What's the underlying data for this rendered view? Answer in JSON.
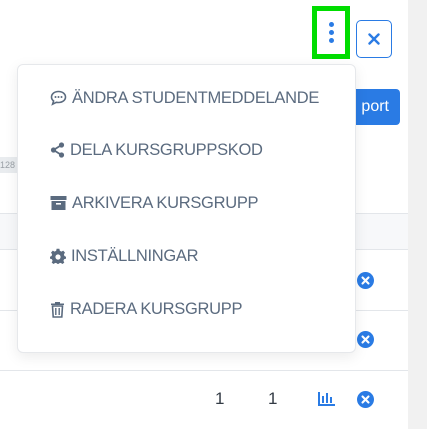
{
  "toolbar": {
    "more_icon": "kebab-vertical-icon",
    "close_icon": "close-x-icon",
    "highlight_color": "#00dd00",
    "accent_color": "#2a7be4"
  },
  "background": {
    "export_label": "port",
    "tag_text": "128"
  },
  "menu": {
    "items": [
      {
        "icon": "speech-bubble-icon",
        "label": "ÄNDRA STUDENTMEDDELANDE"
      },
      {
        "icon": "share-icon",
        "label": "DELA KURSGRUPPSKOD"
      },
      {
        "icon": "archive-icon",
        "label": "ARKIVERA KURSGRUPP"
      },
      {
        "icon": "gear-icon",
        "label": "INSTÄLLNINGAR"
      },
      {
        "icon": "trash-icon",
        "label": "RADERA KURSGRUPP"
      }
    ]
  },
  "table": {
    "last_row": {
      "count_a": "1",
      "count_b": "1",
      "stats_icon": "bar-chart-icon",
      "remove_icon": "remove-circle-icon"
    }
  }
}
